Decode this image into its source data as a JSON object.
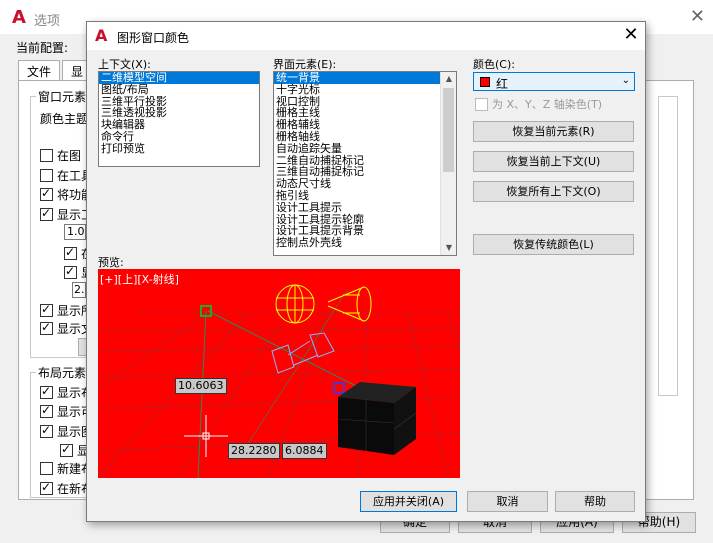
{
  "parent": {
    "title": "选项",
    "current_config_label": "当前配置:",
    "tabs": [
      "文件",
      "显"
    ],
    "groups": [
      {
        "label": "窗口元素"
      },
      {
        "label": "布局元素"
      }
    ],
    "color_theme_label": "颜色主题",
    "checks_top": [
      {
        "text": "在图",
        "checked": false
      },
      {
        "text": "在工具",
        "checked": false
      },
      {
        "text": "将功能",
        "checked": true
      },
      {
        "text": "显示工",
        "checked": true
      }
    ],
    "inner_value_1": "1.0",
    "inner_checks": [
      {
        "text": "在",
        "checked": true
      },
      {
        "text": "显",
        "checked": true
      }
    ],
    "inner_value_2": "2.",
    "checks_mid": [
      {
        "text": "显示所",
        "checked": true
      },
      {
        "text": "显示文",
        "checked": true
      }
    ],
    "checks_layout": [
      {
        "text": "显示布",
        "checked": true
      },
      {
        "text": "显示可",
        "checked": true
      },
      {
        "text": "显示图",
        "checked": true
      },
      {
        "text": "显",
        "checked": true
      },
      {
        "text": "新建布",
        "checked": false
      },
      {
        "text": "在新布",
        "checked": true
      }
    ],
    "buttons": [
      "确定",
      "取消",
      "应用(A)",
      "帮助(H)"
    ]
  },
  "dialog": {
    "title": "图形窗口颜色",
    "context_label": "上下文(X):",
    "context_items": [
      "二维模型空间",
      "图纸/布局",
      "三维平行投影",
      "三维透视投影",
      "块编辑器",
      "命令行",
      "打印预览"
    ],
    "context_selected": 0,
    "element_label": "界面元素(E):",
    "element_items": [
      "统一背景",
      "十字光标",
      "视口控制",
      "栅格主线",
      "栅格辅线",
      "栅格轴线",
      "自动追踪矢量",
      "二维自动捕捉标记",
      "三维自动捕捉标记",
      "动态尺寸线",
      "拖引线",
      "设计工具提示",
      "设计工具提示轮廓",
      "设计工具提示背景",
      "控制点外壳线"
    ],
    "element_selected": 0,
    "color_label": "颜色(C):",
    "color_value": "红",
    "color_hex": "#ff0000",
    "tint_label": "为 X、Y、Z 轴染色(T)",
    "restore_buttons": [
      "恢复当前元素(R)",
      "恢复当前上下文(U)",
      "恢复所有上下文(O)"
    ],
    "restore_classic": "恢复传统颜色(L)",
    "preview_label": "预览:",
    "viewport_label": "[+][上][X-射线]",
    "dimensions": [
      "10.6063",
      "28.2280",
      "6.0884"
    ],
    "bottom_buttons": {
      "apply": "应用并关闭(A)",
      "cancel": "取消",
      "help": "帮助"
    }
  }
}
